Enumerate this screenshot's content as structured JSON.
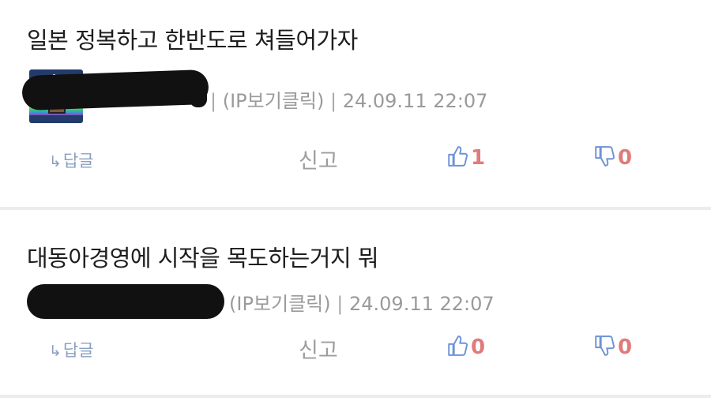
{
  "comments": [
    {
      "text": "일본 정복하고 한반도로 쳐들어가자",
      "meta_separator": "|",
      "ip_label": "(IP보기클릭)",
      "timestamp": "24.09.11 22:07",
      "reply_label": "답글",
      "report_label": "신고",
      "upvotes": "1",
      "downvotes": "0",
      "has_avatar": true
    },
    {
      "text": "대동아경영에 시작을 목도하는거지 뭐",
      "meta_separator": "|",
      "ip_label": "(IP보기클릭)",
      "timestamp": "24.09.11 22:07",
      "reply_label": "답글",
      "report_label": "신고",
      "upvotes": "0",
      "downvotes": "0",
      "has_avatar": false
    }
  ],
  "colors": {
    "accent": "#8aa0c0",
    "vote_count": "#e07b7b",
    "meta_gray": "#9a9a9a",
    "icon_blue": "#6f93d6"
  },
  "icons": {
    "reply": "reply-arrow-icon",
    "like": "thumbs-up-icon",
    "dislike": "thumbs-down-icon"
  }
}
